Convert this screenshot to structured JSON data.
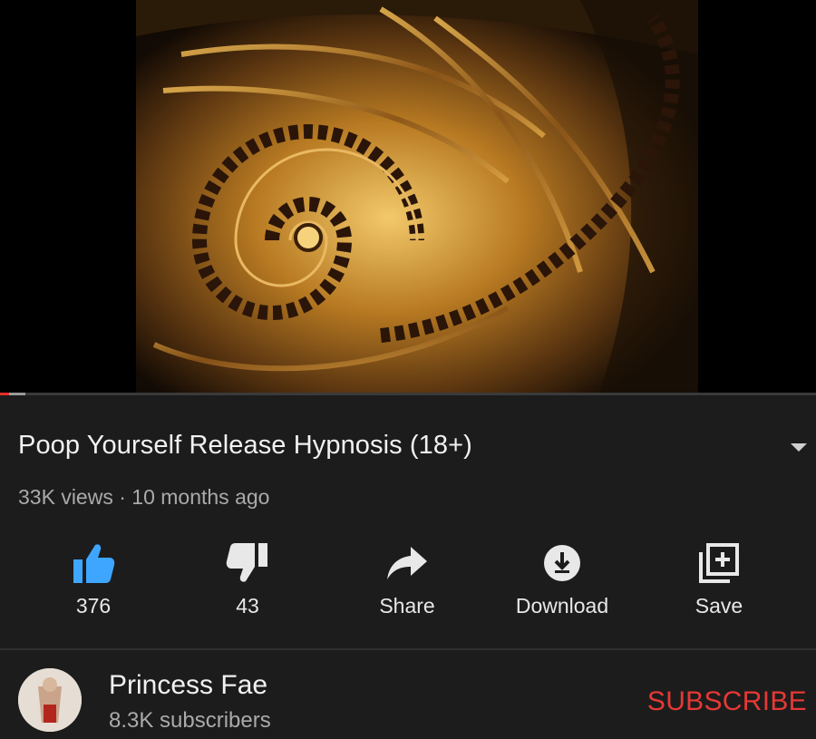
{
  "video": {
    "thumbnail": "golden-spiral-fractal",
    "progress_fraction": 0.03
  },
  "title": "Poop Yourself Release Hypnosis (18+)",
  "meta": {
    "views": "33K views",
    "separator": "·",
    "age": "10 months ago"
  },
  "actions": {
    "like": {
      "label": "376",
      "icon": "thumbs-up-icon",
      "color": "#3ea6ff"
    },
    "dislike": {
      "label": "43",
      "icon": "thumbs-down-icon"
    },
    "share": {
      "label": "Share",
      "icon": "share-arrow-icon"
    },
    "download": {
      "label": "Download",
      "icon": "download-icon"
    },
    "save": {
      "label": "Save",
      "icon": "playlist-add-icon"
    }
  },
  "channel": {
    "name": "Princess Fae",
    "subscribers": "8.3K subscribers",
    "subscribe_label": "SUBSCRIBE",
    "subscribe_color": "#e53935"
  }
}
